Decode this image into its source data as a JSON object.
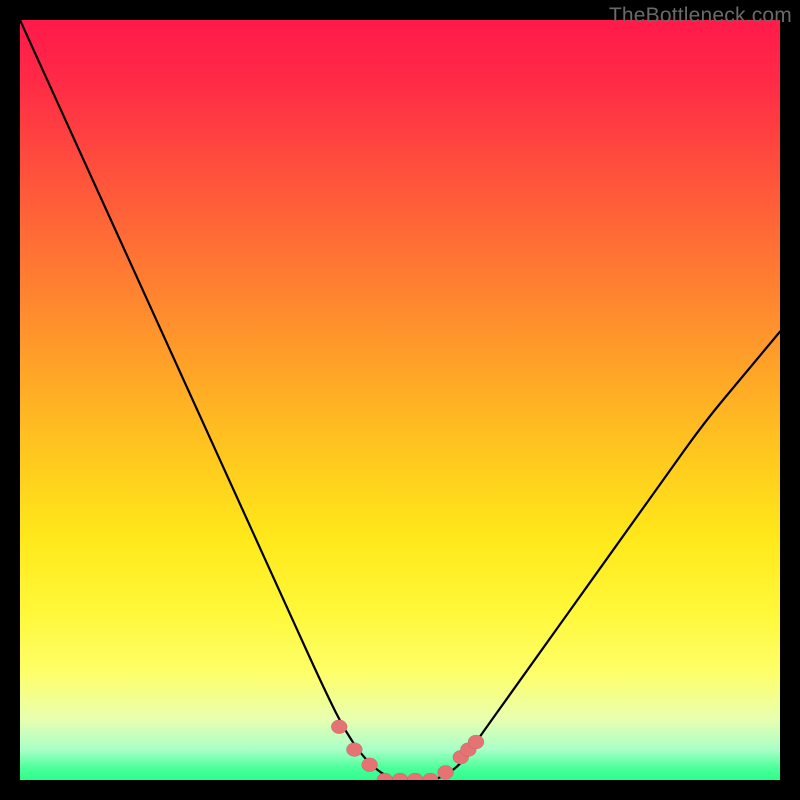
{
  "watermark": "TheBottleneck.com",
  "colors": {
    "frame": "#000000",
    "curve": "#000000",
    "marker": "#e57373"
  },
  "chart_data": {
    "type": "line",
    "title": "",
    "xlabel": "",
    "ylabel": "",
    "xlim": [
      0,
      100
    ],
    "ylim": [
      0,
      100
    ],
    "background_gradient": {
      "top_color_meaning": "high-bottleneck",
      "bottom_color_meaning": "no-bottleneck",
      "stops": [
        {
          "pct": 0,
          "color": "#ff1a4a"
        },
        {
          "pct": 50,
          "color": "#ffca1e"
        },
        {
          "pct": 86,
          "color": "#feff6a"
        },
        {
          "pct": 100,
          "color": "#2aff8a"
        }
      ]
    },
    "series": [
      {
        "name": "bottleneck-curve",
        "x": [
          0,
          5,
          10,
          15,
          20,
          25,
          30,
          35,
          40,
          43,
          46,
          49,
          50,
          52,
          55,
          58,
          60,
          65,
          70,
          75,
          80,
          85,
          90,
          95,
          100
        ],
        "values": [
          100,
          89,
          78,
          67,
          56,
          45,
          34,
          23,
          12,
          6,
          2,
          0,
          0,
          0,
          0,
          2,
          5,
          12,
          19,
          26,
          33,
          40,
          47,
          53,
          59
        ]
      }
    ],
    "markers": {
      "name": "highlighted-points",
      "x": [
        42,
        44,
        46,
        48,
        50,
        52,
        54,
        56,
        58,
        59,
        60
      ],
      "values": [
        7,
        4,
        2,
        0,
        0,
        0,
        0,
        1,
        3,
        4,
        5
      ]
    }
  }
}
